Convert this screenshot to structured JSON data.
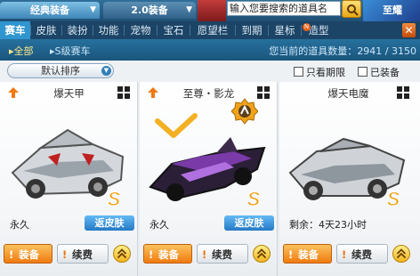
{
  "top_tabs": {
    "classic": "经典装备",
    "v20": "2.0装备"
  },
  "search": {
    "placeholder": "输入您要搜索的道具名"
  },
  "banner": {
    "text": "至耀"
  },
  "categories": [
    {
      "label": "赛车",
      "active": true
    },
    {
      "label": "皮肤"
    },
    {
      "label": "装扮"
    },
    {
      "label": "功能"
    },
    {
      "label": "宠物"
    },
    {
      "label": "宝石"
    },
    {
      "label": "愿望栏"
    },
    {
      "label": "到期"
    },
    {
      "label": "星标"
    },
    {
      "label": "造型"
    }
  ],
  "expiry_badge": "N",
  "subnav": {
    "all": "全部",
    "s_class": "S级赛车",
    "count_label": "您当前的道具数量：",
    "count_value": "2941 / 3150"
  },
  "sort": {
    "value": "默认排序"
  },
  "filters": {
    "expiring_label": "只看期限",
    "equipped_label": "已装备"
  },
  "cards": [
    {
      "name": "爆天甲",
      "duration": "永久",
      "skin_label": "返皮肤",
      "rank": "S",
      "show_up_arrow": true,
      "equip_label": "装备",
      "renew_label": "续费",
      "body_color": "#d4d8dc"
    },
    {
      "name": "至尊・影龙",
      "duration": "永久",
      "skin_label": "返皮肤",
      "rank": "S",
      "show_up_arrow": true,
      "equipped": true,
      "equip_label": "装备",
      "renew_label": "续费",
      "body_color": "#2a1f36"
    },
    {
      "name": "爆天电魔",
      "duration": "剩余：4天23小时",
      "rank": "S",
      "show_up_arrow": false,
      "equip_label": "装备",
      "renew_label": "续费",
      "body_color": "#cfd3d7"
    }
  ],
  "colors": {
    "accent_blue": "#2e95cf",
    "equip_orange": "#ef7a0f",
    "rank_gold": "#f0a21a"
  }
}
